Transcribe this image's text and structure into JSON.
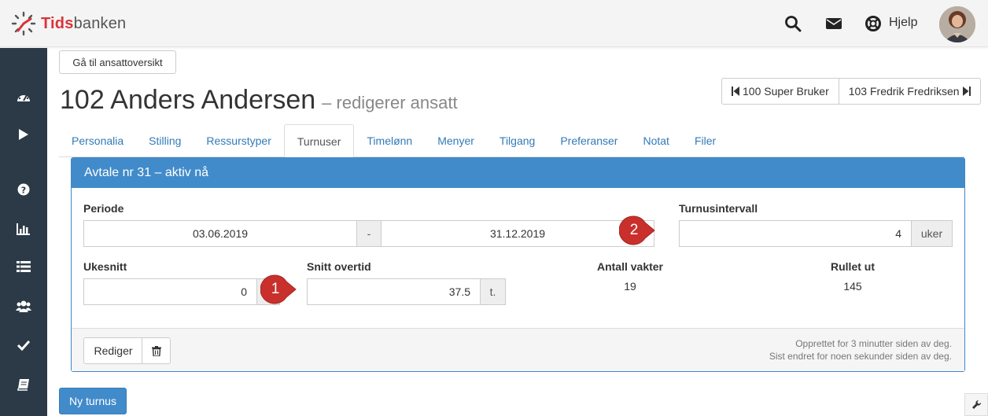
{
  "brand": {
    "logo_part1": "Tids",
    "logo_part2": "banken",
    "accent_color": "#d9343a",
    "primary_color": "#428bca",
    "sidebar_color": "#2b3a46"
  },
  "header": {
    "icons": [
      "search-icon",
      "envelope-icon",
      "lifebuoy-icon"
    ],
    "help_label": "Hjelp"
  },
  "sidebar": {
    "icons": [
      "dashboard-icon",
      "play-icon",
      "question-icon",
      "bar-chart-icon",
      "list-icon",
      "users-icon",
      "check-icon",
      "book-icon"
    ]
  },
  "page": {
    "back_label": "Gå til ansattoversikt",
    "title": "102 Anders Andersen",
    "subtitle": "– redigerer ansatt",
    "prev_employee": "100 Super Bruker",
    "next_employee": "103 Fredrik Fredriksen"
  },
  "tabs": [
    {
      "label": "Personalia",
      "active": false
    },
    {
      "label": "Stilling",
      "active": false
    },
    {
      "label": "Ressurstyper",
      "active": false
    },
    {
      "label": "Turnuser",
      "active": true
    },
    {
      "label": "Timelønn",
      "active": false
    },
    {
      "label": "Menyer",
      "active": false
    },
    {
      "label": "Tilgang",
      "active": false
    },
    {
      "label": "Preferanser",
      "active": false
    },
    {
      "label": "Notat",
      "active": false
    },
    {
      "label": "Filer",
      "active": false
    }
  ],
  "agreement": {
    "heading": "Avtale nr 31 – aktiv nå",
    "period_label": "Periode",
    "period_from": "03.06.2019",
    "period_separator": "-",
    "period_to": "31.12.2019",
    "interval_label": "Turnusintervall",
    "interval_value": "4",
    "interval_unit": "uker",
    "week_avg_label": "Ukesnitt",
    "week_avg_value": "0",
    "overtime_label": "Snitt overtid",
    "overtime_value": "37.5",
    "overtime_unit": "t.",
    "shift_count_label": "Antall vakter",
    "shift_count_value": "19",
    "rolled_label": "Rullet ut",
    "rolled_value": "145",
    "edit_label": "Rediger",
    "created_text": "Opprettet for 3 minutter siden av deg.",
    "changed_text": "Sist endret for noen sekunder siden av deg."
  },
  "actions": {
    "new_label": "Ny turnus"
  },
  "markers": [
    {
      "label": "1",
      "color": "#c9302c"
    },
    {
      "label": "2",
      "color": "#c9302c"
    }
  ]
}
